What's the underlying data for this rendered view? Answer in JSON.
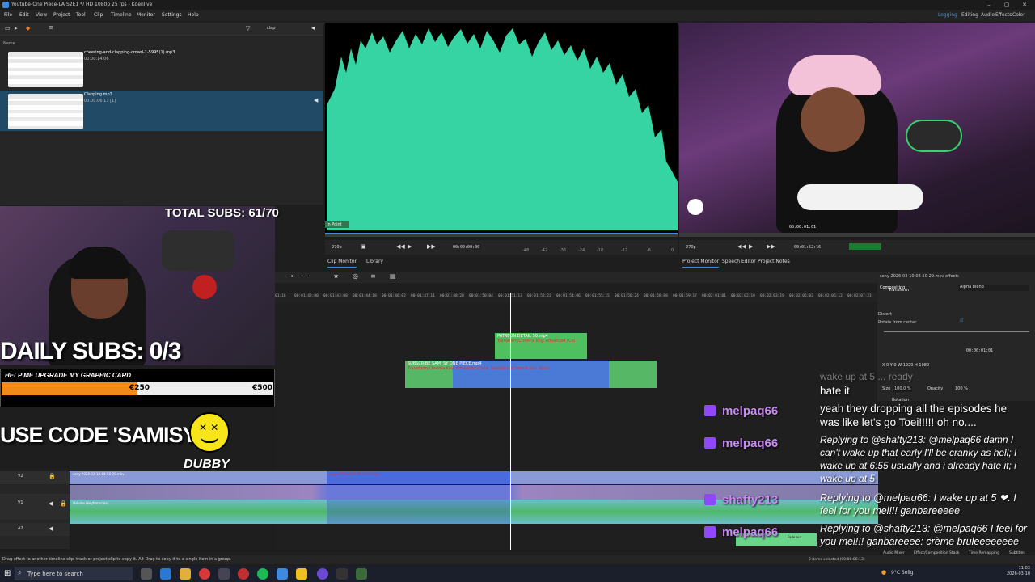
{
  "window": {
    "title": "Youtube-One Piece-LA S2E1 */ HD 1080p 25 fps - Kdenlive",
    "min": "–",
    "max": "▢",
    "close": "✕"
  },
  "menu": [
    "File",
    "Edit",
    "View",
    "Project",
    "Tool",
    "Clip",
    "Timeline",
    "Monitor",
    "Settings",
    "Help"
  ],
  "layouts": [
    "Logging",
    "Editing",
    "Audio",
    "Effects",
    "Color"
  ],
  "bin": {
    "filter_value": "clap",
    "column_name": "Name",
    "clips": [
      {
        "name": "cheering-and-clapping-crowd-1-5995(1).mp3",
        "duration": "00:00:14:06"
      },
      {
        "name": "Clapping.mp3",
        "duration": "00:00:06:13 [1]"
      }
    ]
  },
  "clip_monitor": {
    "label": "In Point",
    "zoom": "270p",
    "timecode": "00:00:00:00",
    "ticks": [
      "-48",
      "-42",
      "-36",
      "-30",
      "-24",
      "-18",
      "-12",
      "-6",
      "0"
    ]
  },
  "monitor_tabs_left": [
    "Clip Monitor",
    "Library"
  ],
  "project_monitor": {
    "zoom": "270p",
    "timecode": "00:01:52:16",
    "top_timecode": "00:00:01:01"
  },
  "monitor_tabs_right": [
    "Project Monitor",
    "Speech Editor",
    "Project Notes"
  ],
  "overlay": {
    "total_subs": "TOTAL SUBS: 61/70",
    "daily_subs": "DAILY SUBS: 0/3",
    "goal_title": "HELP ME UPGRADE MY GRAPHIC CARD",
    "goal_current": "€250",
    "goal_target": "€500",
    "goal_progress": 0.5,
    "code": "USE CODE 'SAMISY'",
    "brand": "DUBBY"
  },
  "timeline": {
    "ruler": [
      "01:16",
      "00:01:42:00",
      "00:01:43:08",
      "00:01:44:18",
      "00:01:46:02",
      "00:01:47:11",
      "00:01:48:20",
      "00:01:50:04",
      "00:01:51:13",
      "00:01:52:22",
      "00:01:54:06",
      "00:01:55:15",
      "00:01:56:24",
      "00:01:58:08",
      "00:01:59:17",
      "00:02:01:01",
      "00:02:02:10",
      "00:02:03:19",
      "00:02:05:03",
      "00:02:06:12",
      "00:02:07:21",
      "00:02:09"
    ],
    "clips": [
      {
        "name": "PATREON DETAIL 50.mp4",
        "effect": "Transform/Chroma Key: Advanced (Col"
      },
      {
        "name": "SUBSCRIBE SAMI SY ONE PIECE.mp4",
        "effect": "Transform/Chroma Key: Advanced (Color Selection)/Chroma Key: Basic"
      }
    ],
    "v_clip_names": [
      "sony-2026-03-10-08-50-29.mkv",
      "sony-2026-03-10-08-50-29.mkv",
      "sony-2026-03-10-08-50-29.mkv",
      "sony-2026-03-10-08-50-29.mkv",
      "sony-2026-03-10-08-50-29.mkv",
      "sony-2026-03-10-08-50-29.mkv",
      "sony-2026-03-10-08-50-29.mkv",
      "sony-2026-03-10-08-50-29.mkv",
      "sony-2026-03-10-08-50-29.mkv",
      "sony-2026-03-10-08-50-29.mkv",
      "sony-2026-03-10-08-50-29.mkv",
      "sony-2026-03-10-08-50-29.mkv"
    ],
    "a_effect": "Volume (keyframable)",
    "tracks": [
      "V2",
      "V1",
      "A1",
      "A2"
    ],
    "fade_out": "Fade out"
  },
  "effects_panel": {
    "clip": "sony-2026-03-10-08-50-29.mkv effects",
    "compositing": "Compositing",
    "blend": "Alpha blend",
    "transform": "Transform",
    "distort": "Distort",
    "rotate": "Rotate from center",
    "pos": "X 0  Y 0  W 1920  H 1080",
    "timecode": "00:00:01:01",
    "size_label": "Size",
    "size_value": "100.0 %",
    "opacity_label": "Opacity",
    "opacity_value": "100 %",
    "rotation": "Rotation"
  },
  "chat": {
    "faded_top": "wake up at 5 ... ready",
    "hate": "hate it",
    "msg1": "yeah they dropping all the episodes he was like let's go Toei!!!!! oh no....",
    "reply1": "Replying to @shafty213: @melpaq66 damn I can't wake up that early I'll be cranky as hell; I wake up at 6:55 usually and i already hate it; i wake up at 5",
    "reply2": "Replying to @melpaq66: I wake up at 5 ❤. I feel for you mel!!! ganbareeeee",
    "reply3": "Replying to @shafty213: @melpaq66 I feel for you mel!!! ganbareeee: crème bruleeeeeeee",
    "users": [
      "melpaq66",
      "melpaq66",
      "shafty213",
      "melpaq66"
    ]
  },
  "status_bar": "Drag effect to another timeline clip, track or project clip to copy it. Alt Drag to copy it to a single item in a group.",
  "status_right": "2 items selected (00:00:06:13)",
  "status_tabs": [
    "Audio Mixer",
    "Effect/Composition Stack",
    "Time Remapping",
    "Subtitles"
  ],
  "taskbar": {
    "search": "Type here to search",
    "weather": "9°C Solig",
    "time": "11:03",
    "date": "2026-03-10"
  }
}
